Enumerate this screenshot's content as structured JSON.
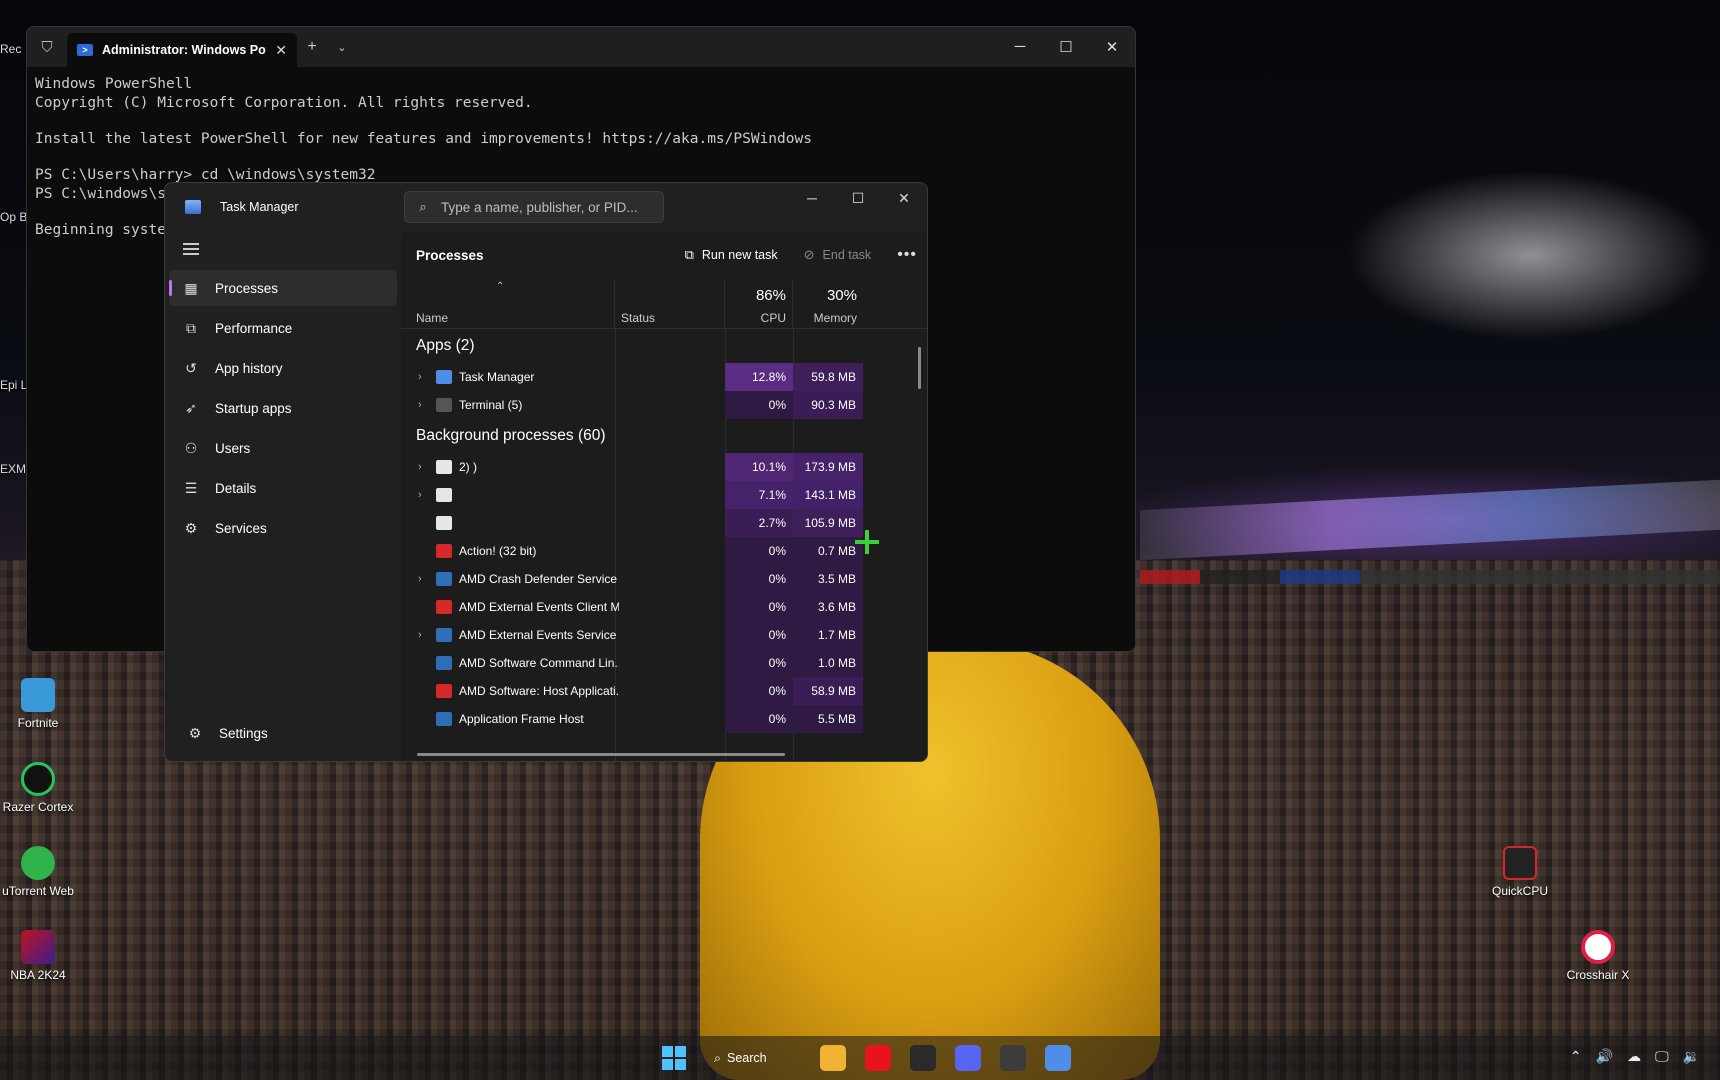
{
  "desktop": {
    "left_edge_labels": [
      "Rec",
      "Op Br",
      "Epi La",
      "EXM"
    ],
    "icons": [
      {
        "label": "Fortnite",
        "color": "#3a9ad9"
      },
      {
        "label": "Razer Cortex",
        "color": "#22c55e"
      },
      {
        "label": "uTorrent Web",
        "color": "#2fb34a"
      },
      {
        "label": "NBA 2K24",
        "color": "#c1121f"
      },
      {
        "label": "QuickCPU",
        "color": "#d62828"
      },
      {
        "label": "Crosshair X",
        "color": "#e11d48"
      }
    ]
  },
  "terminal": {
    "tab_title": "Administrator: Windows PowerShell",
    "lines": [
      "Windows PowerShell",
      "Copyright (C) Microsoft Corporation. All rights reserved.",
      "",
      "Install the latest PowerShell for new features and improvements! https://aka.ms/PSWindows",
      "",
      "PS C:\\Users\\harry> cd \\windows\\system32",
      "PS C:\\windows\\s",
      "",
      "Beginning syste"
    ]
  },
  "task_manager": {
    "title": "Task Manager",
    "search_placeholder": "Type a name, publisher, or PID...",
    "nav": [
      {
        "label": "Processes",
        "icon": "processes-icon",
        "glyph": "▦",
        "active": true
      },
      {
        "label": "Performance",
        "icon": "performance-icon",
        "glyph": "⧉",
        "active": false
      },
      {
        "label": "App history",
        "icon": "app-history-icon",
        "glyph": "↺",
        "active": false
      },
      {
        "label": "Startup apps",
        "icon": "startup-apps-icon",
        "glyph": "➶",
        "active": false
      },
      {
        "label": "Users",
        "icon": "users-icon",
        "glyph": "⚇",
        "active": false
      },
      {
        "label": "Details",
        "icon": "details-icon",
        "glyph": "☰",
        "active": false
      },
      {
        "label": "Services",
        "icon": "services-icon",
        "glyph": "⚙",
        "active": false
      }
    ],
    "settings_label": "Settings",
    "header_title": "Processes",
    "run_new_task": "Run new task",
    "end_task": "End task",
    "columns": {
      "name": "Name",
      "status": "Status",
      "cpu_pct": "86%",
      "cpu": "CPU",
      "mem_pct": "30%",
      "memory": "Memory"
    },
    "groups": [
      {
        "title": "Apps (2)",
        "processes": [
          {
            "name": "Task Manager",
            "expandable": true,
            "icon_color": "#4f8ee8",
            "cpu": "12.8%",
            "mem": "59.8 MB",
            "cpu_bg": "#5a2d82",
            "mem_bg": "#3e1f5a"
          },
          {
            "name": "Terminal (5)",
            "expandable": true,
            "icon_color": "#555555",
            "cpu": "0%",
            "mem": "90.3 MB",
            "cpu_bg": "#2e1a42",
            "mem_bg": "#3a1d55"
          }
        ]
      },
      {
        "title": "Background processes (60)",
        "processes": [
          {
            "name": "2)  )",
            "expandable": true,
            "icon_color": "#e6e6e6",
            "cpu": "10.1%",
            "mem": "173.9 MB",
            "cpu_bg": "#4e2672",
            "mem_bg": "#45226a"
          },
          {
            "name": "",
            "expandable": true,
            "icon_color": "#e6e6e6",
            "cpu": "7.1%",
            "mem": "143.1 MB",
            "cpu_bg": "#45226a",
            "mem_bg": "#42206a"
          },
          {
            "name": "",
            "expandable": false,
            "icon_color": "#e6e6e6",
            "cpu": "2.7%",
            "mem": "105.9 MB",
            "cpu_bg": "#3a1d55",
            "mem_bg": "#3e1f5a"
          },
          {
            "name": "Action! (32 bit)",
            "expandable": false,
            "icon_color": "#d62828",
            "cpu": "0%",
            "mem": "0.7 MB",
            "cpu_bg": "#2e1a42",
            "mem_bg": "#2e1a42"
          },
          {
            "name": "AMD Crash Defender Service",
            "expandable": true,
            "icon_color": "#2f6fb8",
            "cpu": "0%",
            "mem": "3.5 MB",
            "cpu_bg": "#2e1a42",
            "mem_bg": "#2e1a42"
          },
          {
            "name": "AMD External Events Client M...",
            "expandable": false,
            "icon_color": "#d62828",
            "cpu": "0%",
            "mem": "3.6 MB",
            "cpu_bg": "#2e1a42",
            "mem_bg": "#2e1a42"
          },
          {
            "name": "AMD External Events Service ...",
            "expandable": true,
            "icon_color": "#2f6fb8",
            "cpu": "0%",
            "mem": "1.7 MB",
            "cpu_bg": "#2e1a42",
            "mem_bg": "#2e1a42"
          },
          {
            "name": "AMD Software Command Lin...",
            "expandable": false,
            "icon_color": "#2f6fb8",
            "cpu": "0%",
            "mem": "1.0 MB",
            "cpu_bg": "#2e1a42",
            "mem_bg": "#2e1a42"
          },
          {
            "name": "AMD Software: Host Applicati...",
            "expandable": false,
            "icon_color": "#d62828",
            "cpu": "0%",
            "mem": "58.9 MB",
            "cpu_bg": "#2e1a42",
            "mem_bg": "#3a1d55"
          },
          {
            "name": "Application Frame Host",
            "expandable": false,
            "icon_color": "#2f6fb8",
            "cpu": "0%",
            "mem": "5.5 MB",
            "cpu_bg": "#2e1a42",
            "mem_bg": "#2e1a42"
          }
        ]
      }
    ]
  },
  "taskbar": {
    "search_label": "Search",
    "apps": [
      {
        "name": "file-explorer-icon",
        "color": "#f2b233"
      },
      {
        "name": "opera-icon",
        "color": "#e8131c"
      },
      {
        "name": "epic-games-icon",
        "color": "#2a2a2a"
      },
      {
        "name": "discord-icon",
        "color": "#5865f2"
      },
      {
        "name": "terminal-icon",
        "color": "#3b3b3b"
      },
      {
        "name": "task-manager-icon",
        "color": "#4f8ee8"
      }
    ]
  }
}
